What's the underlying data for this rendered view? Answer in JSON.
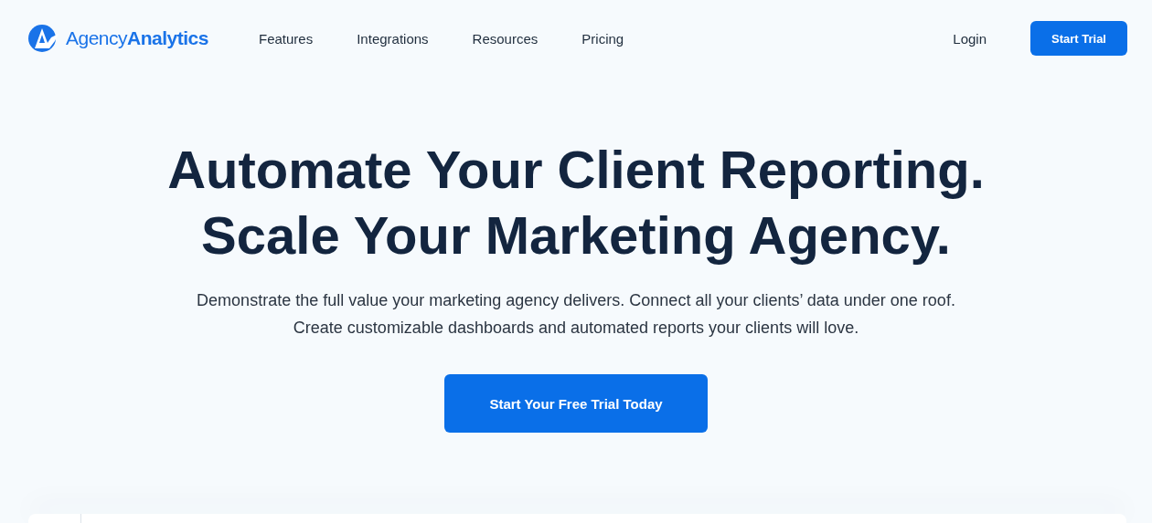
{
  "header": {
    "logo": "Agency**Analytics**",
    "nav": [
      "Features",
      "Integrations",
      "Resources",
      "Pricing"
    ],
    "login": "Login",
    "cta": "Start Trial"
  },
  "hero": {
    "title_lines": [
      "Automate Your Client Reporting.",
      "Scale Your Marketing Agency."
    ],
    "subtitle": "Demonstrate the full value your marketing agency delivers. Connect all your clients’ data under one roof. Create customizable dashboards and automated reports your clients will love.",
    "cta": "Start Your Free Trial Today"
  }
}
